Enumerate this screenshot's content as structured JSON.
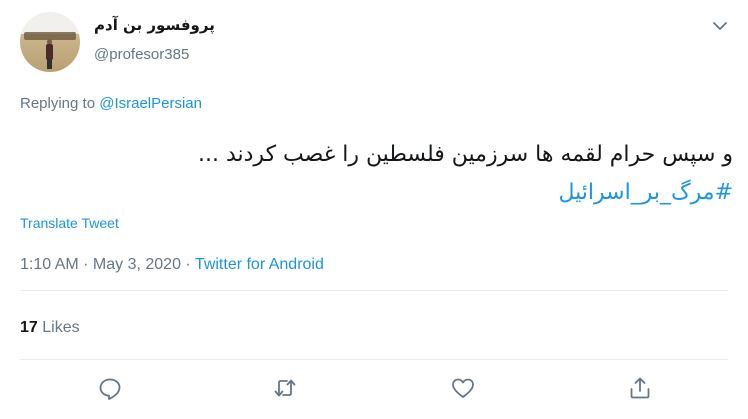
{
  "author": {
    "display_name": "پروفسور بن آدم",
    "handle": "@profesor385"
  },
  "reply": {
    "prefix": "Replying to ",
    "to_handle": "@IsraelPersian"
  },
  "tweet": {
    "line1": "و سپس حرام لقمه ها سرزمین فلسطین را غصب کردند ...",
    "hashtag": "#مرگ_بر_اسرائیل"
  },
  "translate_label": "Translate Tweet",
  "meta": {
    "time": "1:10 AM",
    "sep1": " · ",
    "date": "May 3, 2020",
    "sep2": " · ",
    "source": "Twitter for Android"
  },
  "stats": {
    "likes_count": "17",
    "likes_label": " Likes"
  },
  "icons": {
    "reply": "reply-icon",
    "retweet": "retweet-icon",
    "like": "heart-icon",
    "share": "share-icon",
    "caret": "chevron-down-icon"
  },
  "colors": {
    "link": "#1b95e0",
    "muted": "#657786",
    "text": "#14171a",
    "divider": "#e6ecf0"
  }
}
